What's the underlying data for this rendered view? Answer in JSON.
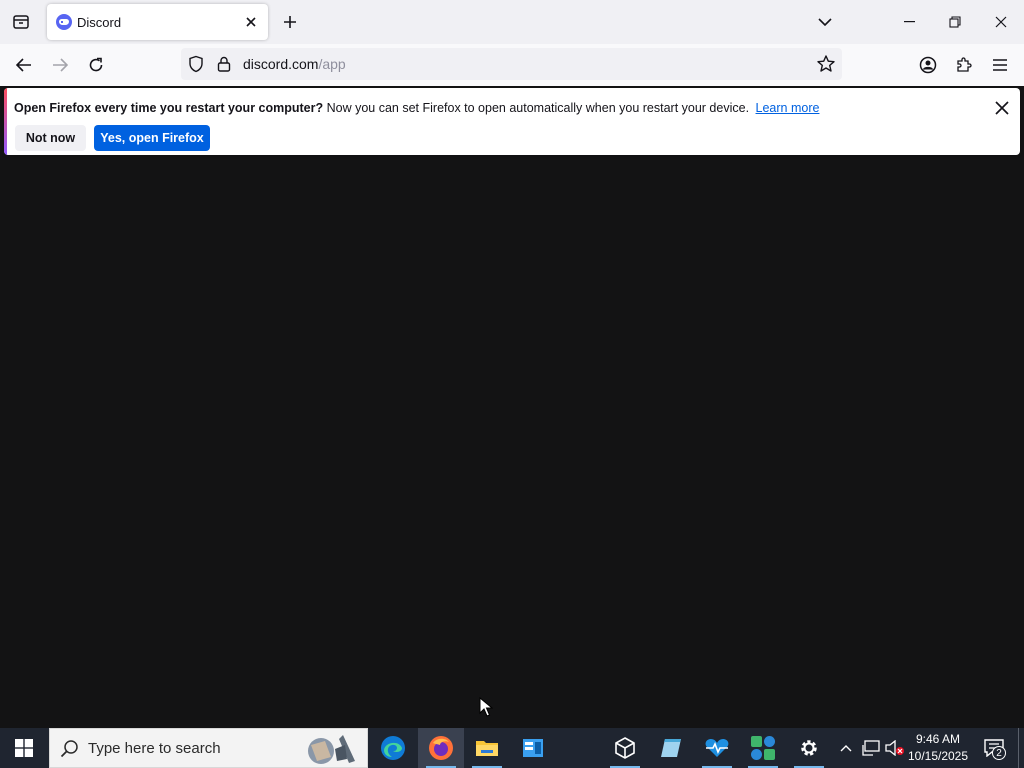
{
  "browser": {
    "tab": {
      "title": "Discord"
    },
    "url": {
      "host": "discord.com",
      "path": "/app"
    }
  },
  "notification": {
    "title": "Open Firefox every time you restart your computer?",
    "body": "Now you can set Firefox to open automatically when you restart your device.",
    "link": "Learn more",
    "secondary_button": "Not now",
    "primary_button": "Yes, open Firefox"
  },
  "taskbar": {
    "search_placeholder": "Type here to search",
    "time": "9:46 AM",
    "date": "10/15/2025",
    "notification_count": "2",
    "apps": [
      "edge-icon",
      "firefox-icon",
      "file-explorer-icon",
      "app-icon",
      "3d-viewer-icon",
      "notepad-icon",
      "health-icon",
      "widgets-icon",
      "settings-icon"
    ]
  },
  "colors": {
    "page_background": "#131314",
    "primary_button": "#0061e0",
    "taskbar": "#1f2530"
  }
}
